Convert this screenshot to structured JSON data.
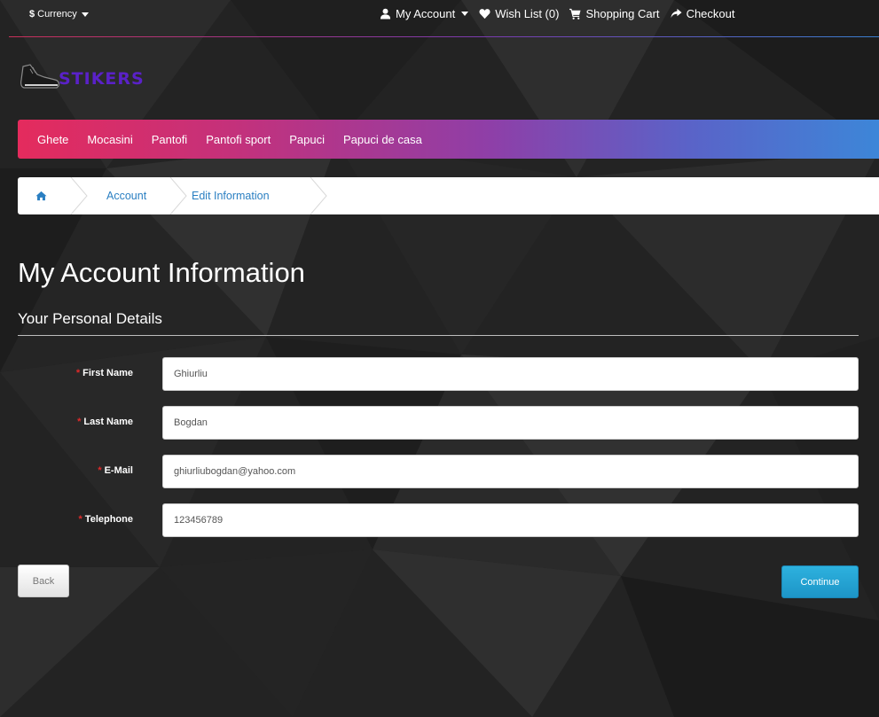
{
  "colors": {
    "nav_gradient_start": "#e42b5d",
    "nav_gradient_end": "#3d86d8",
    "logo": "#5a21c8",
    "link": "#2a7fc2",
    "required": "#e02a2a",
    "continue_button": "#1d95c7"
  },
  "topbar": {
    "currency_symbol": "$",
    "currency_label": "Currency",
    "links": {
      "my_account": "My Account",
      "wish_list": "Wish List (0)",
      "shopping_cart": "Shopping Cart",
      "checkout": "Checkout"
    },
    "icons": {
      "my_account": "user-icon",
      "wish_list": "heart-icon",
      "shopping_cart": "cart-icon",
      "checkout": "share-arrow-icon"
    }
  },
  "logo": {
    "text": "STIKERS",
    "icon": "sneaker-icon"
  },
  "nav": {
    "items": [
      "Ghete",
      "Mocasini",
      "Pantofi",
      "Pantofi sport",
      "Papuci",
      "Papuci de casa"
    ]
  },
  "breadcrumb": {
    "home_icon": "home-icon",
    "items": [
      "Account",
      "Edit Information"
    ]
  },
  "page": {
    "title": "My Account Information",
    "subtitle": "Your Personal Details"
  },
  "form": {
    "required_marker": "*",
    "fields": [
      {
        "label": "First Name",
        "value": "Ghiurliu"
      },
      {
        "label": "Last Name",
        "value": "Bogdan"
      },
      {
        "label": "E-Mail",
        "value": "ghiurliubogdan@yahoo.com"
      },
      {
        "label": "Telephone",
        "value": "123456789"
      }
    ]
  },
  "buttons": {
    "back": "Back",
    "continue": "Continue"
  }
}
